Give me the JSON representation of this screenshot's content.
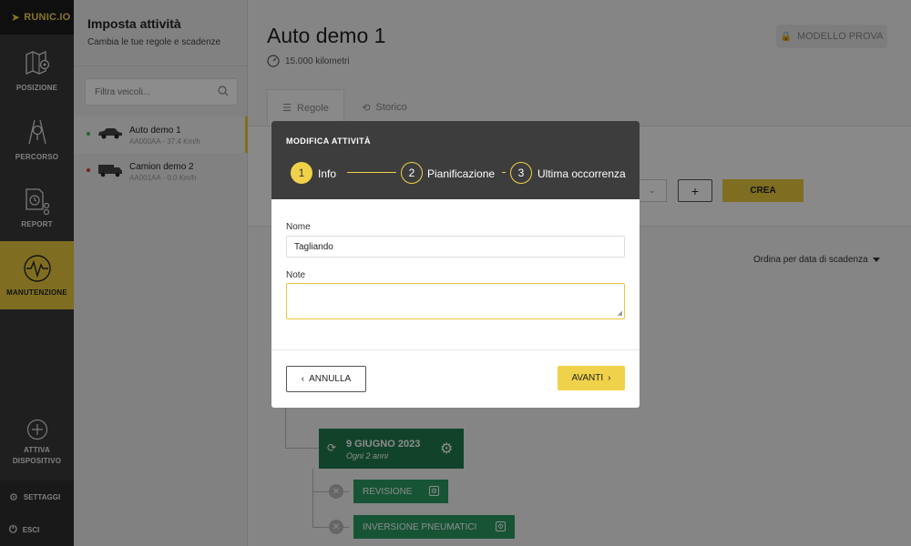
{
  "app": {
    "logo": "RUNIC.IO"
  },
  "nav": {
    "items": [
      {
        "label": "POSIZIONE",
        "icon": "map-pin-icon"
      },
      {
        "label": "PERCORSO",
        "icon": "route-icon"
      },
      {
        "label": "REPORT",
        "icon": "report-icon"
      },
      {
        "label": "MANUTENZIONE",
        "icon": "maintenance-icon"
      }
    ],
    "activate_line1": "ATTIVA",
    "activate_line2": "DISPOSITIVO",
    "settings": "SETTAGGI",
    "logout": "ESCI"
  },
  "vehicles": {
    "title": "Imposta attività",
    "subtitle": "Cambia le tue regole e scadenze",
    "search_placeholder": "Filtra veicoli...",
    "items": [
      {
        "name": "Auto demo 1",
        "sub": "AA000AA - 37.4 Km/h",
        "status_color": "#3db85c"
      },
      {
        "name": "Camion demo 2",
        "sub": "AA001AA - 0.0 Km/h",
        "status_color": "#d63c3c"
      }
    ]
  },
  "main": {
    "title": "Auto demo 1",
    "km": "15.000 kilometri",
    "modello": "MODELLO PROVA",
    "tabs": [
      {
        "label": "Regole"
      },
      {
        "label": "Storico"
      }
    ],
    "crea": "CREA",
    "plus": "+",
    "sort": "Ordina per data di scadenza",
    "timeline": {
      "date": "9 GIUGNO 2023",
      "recurrence": "Ogni 2 anni",
      "tasks": [
        "REVISIONE",
        "INVERSIONE PNEUMATICI"
      ]
    }
  },
  "modal": {
    "title": "MODIFICA ATTIVITÀ",
    "steps": [
      {
        "num": "1",
        "label": "Info"
      },
      {
        "num": "2",
        "label": "Pianificazione"
      },
      {
        "num": "3",
        "label": "Ultima occorrenza"
      }
    ],
    "name_label": "Nome",
    "name_value": "Tagliando",
    "notes_label": "Note",
    "cancel": "ANNULLA",
    "next": "AVANTI"
  },
  "colors": {
    "accent": "#e8c83c",
    "nav_bg": "#3a3a3a",
    "green": "#1f7a4d"
  }
}
